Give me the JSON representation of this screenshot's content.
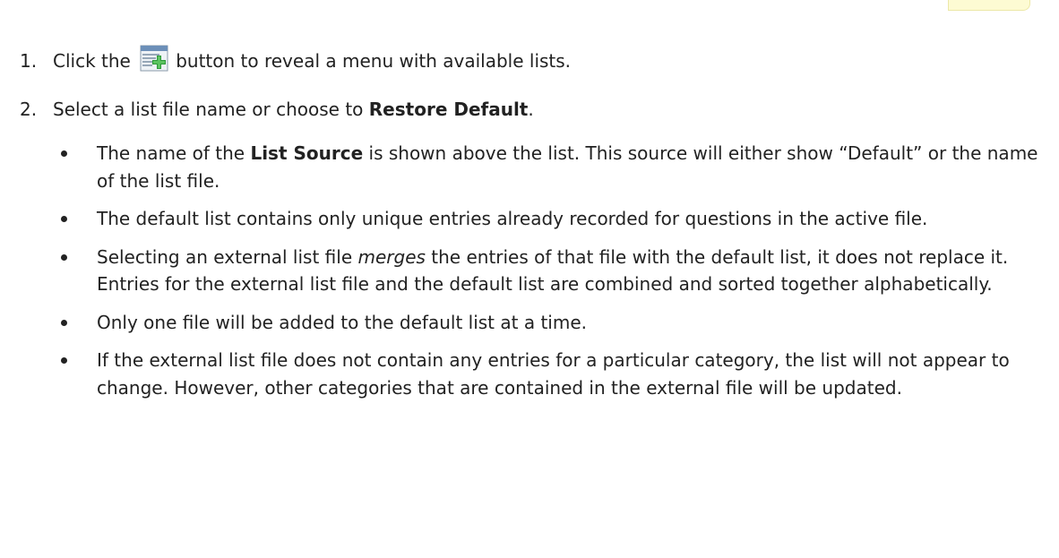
{
  "step1": {
    "number": "1.",
    "text_before": "Click the",
    "icon": "add-list-icon",
    "text_after": "button to reveal a menu with available lists."
  },
  "step2": {
    "number": "2.",
    "text_before": "Select a list file name or choose to",
    "bold": "Restore Default",
    "text_after": "."
  },
  "bullets": [
    {
      "t1": "The name of the ",
      "b1": "List Source",
      "t2": " is shown above the list. This source will either show “Default” or the name of the list file."
    },
    {
      "t1": "The default list contains only unique entries already recorded for questions in the active file."
    },
    {
      "t1": "Selecting an external list file ",
      "i1": "merges",
      "t2": " the entries of that file with the default list, it does not replace it. Entries for the external list file and the default list are combined and sorted together alphabetically."
    },
    {
      "t1": "Only one file will be added to the default list at a time."
    },
    {
      "t1": "If the external list file does not contain any entries for a particular category, the list will not appear to change. However, other categories that are contained in the external file will be updated."
    }
  ]
}
